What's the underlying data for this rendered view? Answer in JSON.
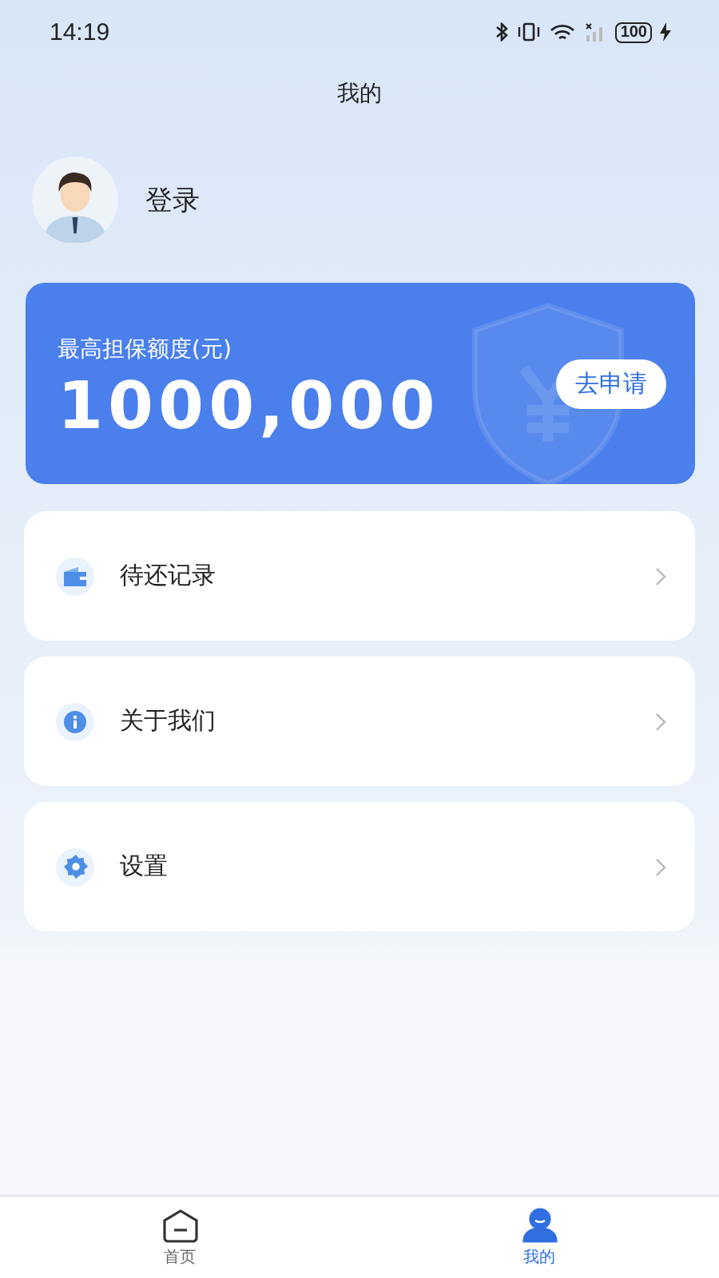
{
  "status_bar": {
    "time": "14:19",
    "battery": "100"
  },
  "header": {
    "title": "我的"
  },
  "profile": {
    "login": "登录"
  },
  "credit_card": {
    "label": "最高担保额度(元)",
    "amount": "1000,000",
    "button": "去申请"
  },
  "menu": [
    {
      "kind": "wallet",
      "label": "待还记录"
    },
    {
      "kind": "info",
      "label": "关于我们"
    },
    {
      "kind": "settings",
      "label": "设置"
    }
  ],
  "tabs": [
    {
      "kind": "home",
      "label": "首页",
      "selected": false
    },
    {
      "kind": "user",
      "label": "我的",
      "selected": true
    }
  ]
}
